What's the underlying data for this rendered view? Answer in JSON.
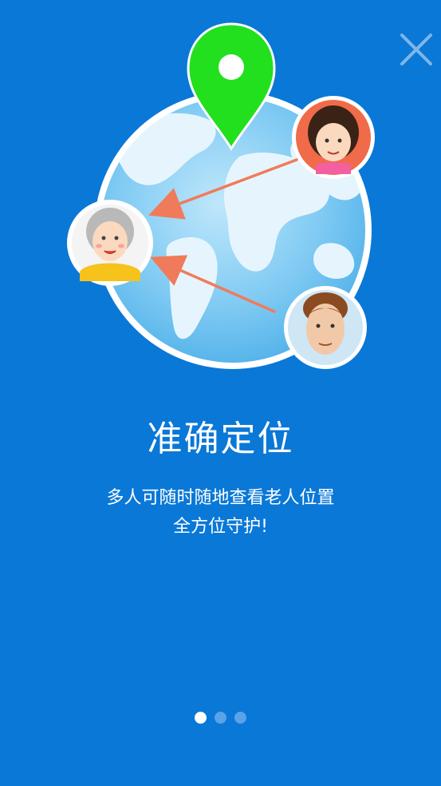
{
  "close_icon": "close-icon",
  "title": "准确定位",
  "subtitle": {
    "line1": "多人可随时随地查看老人位置",
    "line2": "全方位守护!"
  },
  "page_indicator": {
    "total": 3,
    "current": 1
  },
  "colors": {
    "background": "#0a78d7",
    "globe_water": "#8fd0f5",
    "globe_land": "#eaf6fd",
    "pin": "#22e01e",
    "arrow": "#f07b5a"
  }
}
